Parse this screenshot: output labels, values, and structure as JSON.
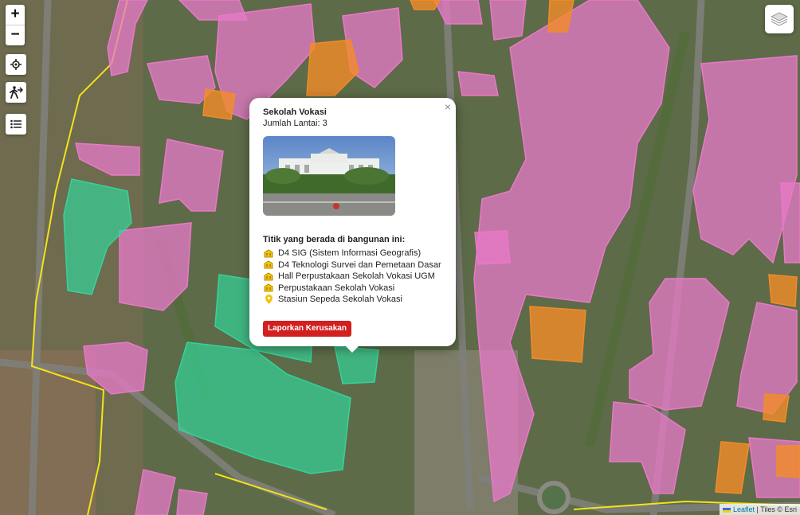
{
  "map": {
    "controls": {
      "zoom_in": "+",
      "zoom_out": "−",
      "locate_icon": "crosshair-icon",
      "route_icon": "walking-icon",
      "legend_icon": "list-icon",
      "layers_icon": "layers-icon"
    },
    "colors": {
      "building": "#e879c8",
      "school": "#34d399",
      "other": "#f28c28",
      "boundary": "#f3e21b",
      "report": "#d21f1f"
    }
  },
  "popup": {
    "title": "Sekolah Vokasi",
    "floors": "Jumlah Lantai: 3",
    "photo_label": "Sekolah Vokasi building photo",
    "points_heading": "Titik yang berada di bangunan ini:",
    "points": [
      {
        "icon": "building-icon",
        "label": "D4 SIG (Sistem Informasi Geografis)"
      },
      {
        "icon": "building-icon",
        "label": "D4 Teknologi Survei dan Pemetaan Dasar"
      },
      {
        "icon": "building-icon",
        "label": "Hall Perpustakaan Sekolah Vokasi UGM"
      },
      {
        "icon": "building-icon",
        "label": "Perpustakaan Sekolah Vokasi"
      },
      {
        "icon": "pin-icon",
        "label": "Stasiun Sepeda Sekolah Vokasi"
      }
    ],
    "report_button": "Laporkan Kerusakan",
    "close": "×"
  },
  "attribution": {
    "leaflet": "Leaflet",
    "tiles": "| Tiles © Esri"
  }
}
